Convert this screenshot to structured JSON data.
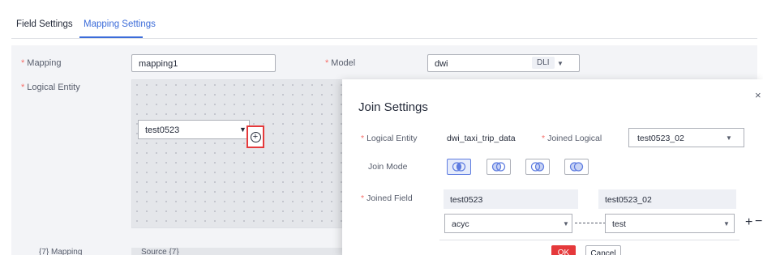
{
  "tabs": [
    {
      "label": "Field Settings",
      "active": false
    },
    {
      "label": "Mapping Settings",
      "active": true
    }
  ],
  "form": {
    "required_mark": "*",
    "mapping_label": "Mapping",
    "mapping_value": "mapping1",
    "model_label": "Model",
    "model_value": "dwi",
    "model_tag": "DLI",
    "logical_entity_label": "Logical Entity",
    "entity_value": "test0523",
    "mapping_count_label": "{7} Mapping",
    "source_label": "Source {7}"
  },
  "dialog": {
    "title": "Join Settings",
    "close_glyph": "×",
    "logical_entity_label": "Logical Entity",
    "logical_entity_value": "dwi_taxi_trip_data",
    "joined_logical_label": "Joined Logical",
    "joined_logical_value": "test0523_02",
    "join_mode_label": "Join Mode",
    "join_modes": [
      "inner-join",
      "left-join",
      "right-join",
      "full-join"
    ],
    "selected_join_mode": "inner-join",
    "joined_field_label": "Joined Field",
    "left_table": "test0523",
    "right_table": "test0523_02",
    "left_field": "acyc",
    "right_field": "test",
    "add_glyph": "+",
    "remove_glyph": "−",
    "ok_label": "OK",
    "cancel_label": "Cancel"
  },
  "colors": {
    "accent": "#3c6cd9",
    "danger": "#e5393b",
    "required": "#f66f6a",
    "panel_bg": "#f3f4f7"
  },
  "icons": {
    "caret": "chevron-down-icon",
    "add_entity": "plus-circle-icon",
    "close": "close-icon"
  }
}
